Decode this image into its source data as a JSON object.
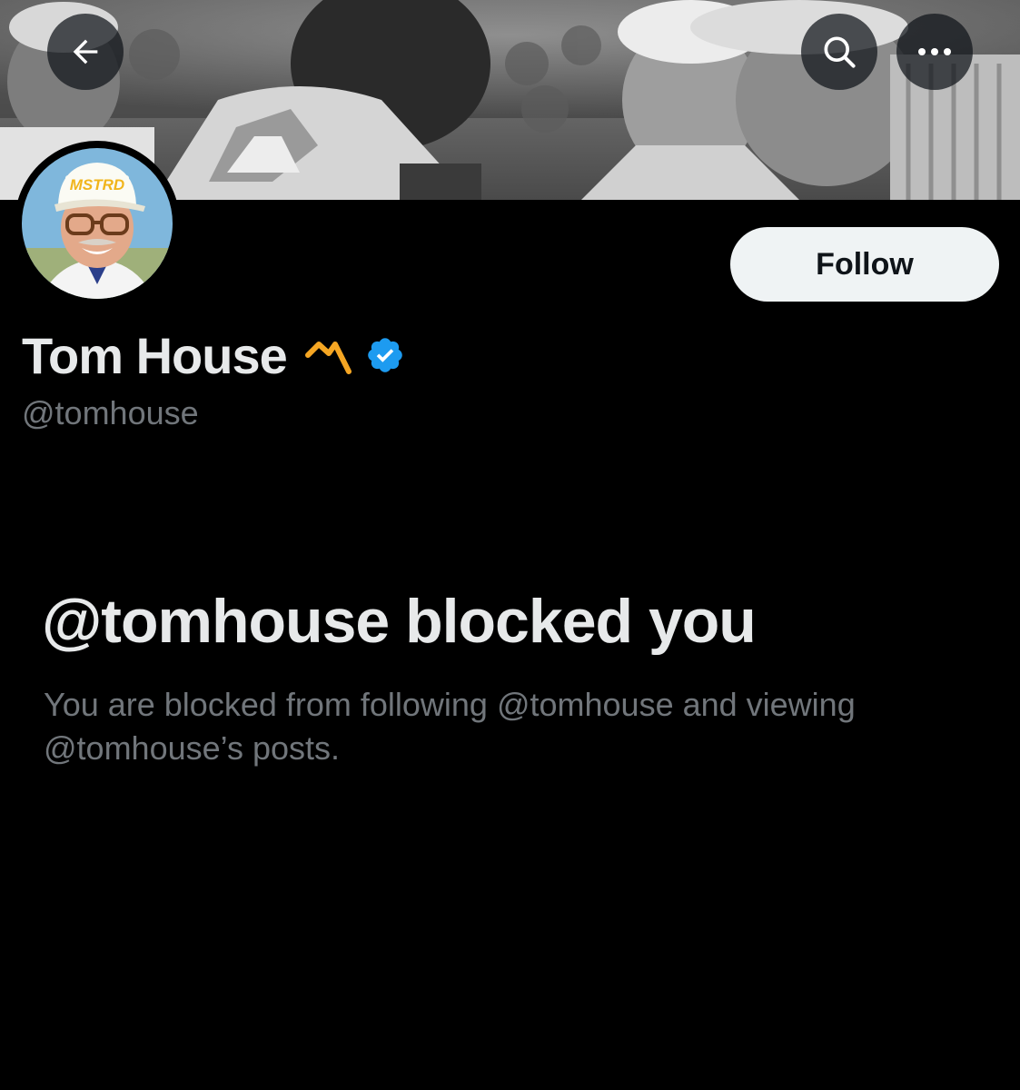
{
  "header": {
    "back_icon": "arrow-left-icon",
    "search_icon": "search-icon",
    "more_icon": "more-horizontal-icon"
  },
  "profile": {
    "display_name": "Tom House",
    "handle": "@tomhouse",
    "avatar_cap_text": "MSTRD",
    "badge_icon": "m-logo-icon",
    "badge_color": "#f5a623",
    "verified_icon": "verified-badge-icon",
    "verified_color": "#1d9bf0"
  },
  "actions": {
    "follow_label": "Follow"
  },
  "blocked": {
    "title": "@tomhouse blocked you",
    "description": "You are blocked from following @tomhouse and viewing @tomhouse’s posts."
  },
  "colors": {
    "background": "#000000",
    "primary_text": "#e7e9ea",
    "secondary_text": "#71767b",
    "button_bg": "#eff3f4"
  }
}
